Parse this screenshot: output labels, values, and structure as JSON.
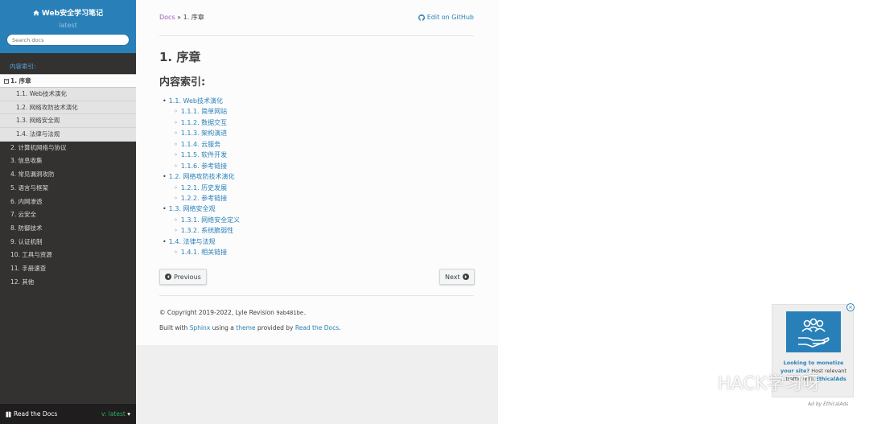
{
  "sidebar": {
    "title": "Web安全学习笔记",
    "version": "latest",
    "search_placeholder": "Search docs",
    "caption": "内容索引:",
    "current": "1. 序章",
    "toggle": "−",
    "sub_items": [
      {
        "label": "1.1. Web技术演化"
      },
      {
        "label": "1.2. 网络攻防技术演化"
      },
      {
        "label": "1.3. 网络安全观"
      },
      {
        "label": "1.4. 法律与法规"
      }
    ],
    "items": [
      {
        "label": "2. 计算机网络与协议"
      },
      {
        "label": "3. 信息收集"
      },
      {
        "label": "4. 常见漏洞攻防"
      },
      {
        "label": "5. 语言与框架"
      },
      {
        "label": "6. 内网渗透"
      },
      {
        "label": "7. 云安全"
      },
      {
        "label": "8. 防御技术"
      },
      {
        "label": "9. 认证机制"
      },
      {
        "label": "10. 工具与资源"
      },
      {
        "label": "11. 手册速查"
      },
      {
        "label": "12. 其他"
      }
    ],
    "footer_rtd": "Read the Docs",
    "footer_version": "v: latest"
  },
  "breadcrumb": {
    "docs": "Docs",
    "sep": "»",
    "current": "1. 序章",
    "github": "Edit on GitHub"
  },
  "page": {
    "title": "1. 序章",
    "subtitle": "内容索引:",
    "toc": [
      {
        "label": "1.1. Web技术演化",
        "level": 1
      },
      {
        "label": "1.1.1. 简单网站",
        "level": 2
      },
      {
        "label": "1.1.2. 数据交互",
        "level": 2
      },
      {
        "label": "1.1.3. 架构演进",
        "level": 2
      },
      {
        "label": "1.1.4. 云服务",
        "level": 2
      },
      {
        "label": "1.1.5. 软件开发",
        "level": 2
      },
      {
        "label": "1.1.6. 参考链接",
        "level": 2
      },
      {
        "label": "1.2. 网络攻防技术演化",
        "level": 1
      },
      {
        "label": "1.2.1. 历史发展",
        "level": 2
      },
      {
        "label": "1.2.2. 参考链接",
        "level": 2
      },
      {
        "label": "1.3. 网络安全观",
        "level": 1
      },
      {
        "label": "1.3.1. 网络安全定义",
        "level": 2
      },
      {
        "label": "1.3.2. 系统脆弱性",
        "level": 2
      },
      {
        "label": "1.4. 法律与法规",
        "level": 1
      },
      {
        "label": "1.4.1. 相关链接",
        "level": 2
      }
    ],
    "prev": "Previous",
    "next": "Next"
  },
  "footer": {
    "copyright": "© Copyright 2019-2022, Lyle Revision",
    "revision": "9ab481be.",
    "built_with": "Built with",
    "sphinx": "Sphinx",
    "using_a": "using a",
    "theme": "theme",
    "provided_by": "provided by",
    "rtd": "Read the Docs",
    "period": "."
  },
  "ad": {
    "close": "×",
    "headline": "Looking to monetize your site?",
    "body": "Host relevant",
    "partial": "...traffic with",
    "brand": "EthicalAds",
    "by": "Ad by EthicalAds"
  },
  "watermark": "HACK学习呀",
  "colors": {
    "sidebar_bg": "#343131",
    "sidebar_head": "#2980b9",
    "link": "#2980b9",
    "visited": "#9b59b6",
    "version_green": "#27ae60"
  }
}
